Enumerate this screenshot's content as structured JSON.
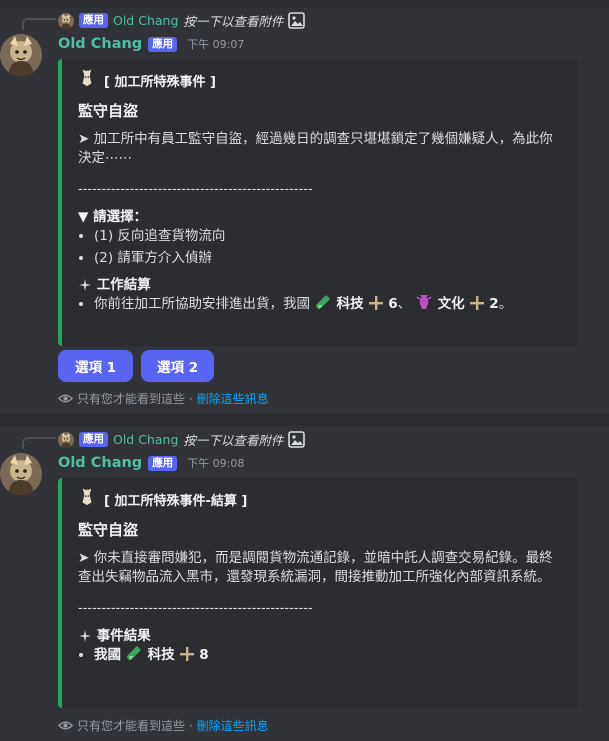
{
  "messages": [
    {
      "reply": {
        "badge": "應用",
        "name": "Old Chang",
        "text": "按一下以查看附件"
      },
      "author": "Old Chang",
      "badge": "應用",
      "timestamp": "下午 09:07",
      "embed": {
        "title": "[ 加工所特殊事件 ]",
        "subtitle": "監守自盜",
        "description": "➤ 加工所中有員工監守自盜，經過幾日的調查只堪堪鎖定了幾個嫌疑人，為此你決定⋯⋯",
        "rule": "--------------------------------------------------",
        "fields": [
          {
            "name": "▼ 請選擇：",
            "items": [
              "(1) 反向追查貨物流向",
              "(2) 請軍方介入偵辦"
            ]
          },
          {
            "name": "工作結算",
            "result": {
              "prefix": "你前往加工所協助安排進出貨，我國",
              "stat1": "科技",
              "val1": "6",
              "sep": "、",
              "stat2": "文化",
              "val2": "2",
              "end": "。"
            }
          }
        ]
      },
      "buttons": [
        "選項 1",
        "選項 2"
      ],
      "ephemeral": {
        "text": "只有您才能看到這些 · ",
        "link": "刪除這些訊息"
      }
    },
    {
      "reply": {
        "badge": "應用",
        "name": "Old Chang",
        "text": "按一下以查看附件"
      },
      "author": "Old Chang",
      "badge": "應用",
      "timestamp": "下午 09:08",
      "embed": {
        "title": "[ 加工所特殊事件-結算 ]",
        "subtitle": "監守自盜",
        "description": "➤ 你未直接審問嫌犯，而是調閱貨物流通記錄，並暗中託人調查交易紀錄。最終查出失竊物品流入黑市，還發現系統漏洞，間接推動加工所強化內部資訊系統。",
        "rule": "--------------------------------------------------",
        "fields": [
          {
            "name": "事件結果",
            "result": {
              "prefix": "我國",
              "stat1": "科技",
              "val1": "8"
            }
          }
        ]
      },
      "ephemeral": {
        "text": "只有您才能看到這些 · ",
        "link": "刪除這些訊息"
      }
    }
  ],
  "colors": {
    "background": "#313338",
    "embed": "#2b2d31",
    "embed_bar": "#23a55a",
    "button": "#5865f2",
    "name": "#4fbfa4",
    "link": "#00a8fc"
  }
}
